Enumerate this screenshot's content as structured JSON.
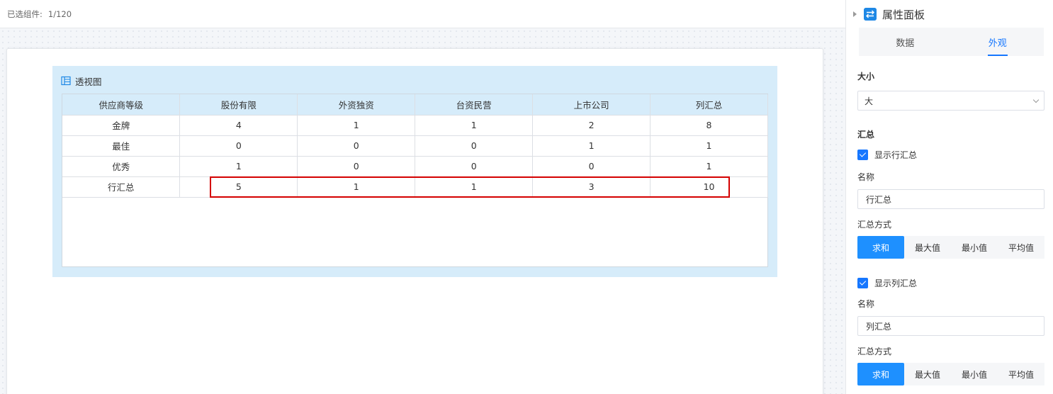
{
  "topbar": {
    "selected_label": "已选组件:",
    "selected_count": "1/120"
  },
  "widget": {
    "title": "透视图",
    "table": {
      "headers": [
        "供应商等级",
        "股份有限",
        "外资独资",
        "台资民营",
        "上市公司",
        "列汇总"
      ],
      "rows": [
        [
          "金牌",
          "4",
          "1",
          "1",
          "2",
          "8"
        ],
        [
          "最佳",
          "0",
          "0",
          "0",
          "1",
          "1"
        ],
        [
          "优秀",
          "1",
          "0",
          "0",
          "0",
          "1"
        ],
        [
          "行汇总",
          "5",
          "1",
          "1",
          "3",
          "10"
        ]
      ]
    }
  },
  "panel": {
    "title": "属性面板",
    "tabs": [
      "数据",
      "外观"
    ],
    "active_tab": "外观",
    "size": {
      "section": "大小",
      "value": "大"
    },
    "summary": {
      "section": "汇总",
      "row": {
        "checkbox_label": "显示行汇总",
        "name_label": "名称",
        "name_value": "行汇总",
        "method_label": "汇总方式",
        "methods": [
          "求和",
          "最大值",
          "最小值",
          "平均值"
        ],
        "active_method": "求和"
      },
      "col": {
        "checkbox_label": "显示列汇总",
        "name_label": "名称",
        "name_value": "列汇总",
        "method_label": "汇总方式",
        "methods": [
          "求和",
          "最大值",
          "最小值",
          "平均值"
        ],
        "active_method": "求和"
      }
    }
  },
  "colors": {
    "accent": "#1677ff",
    "widget_bg": "#d6ecfa",
    "highlight": "#d40000"
  }
}
